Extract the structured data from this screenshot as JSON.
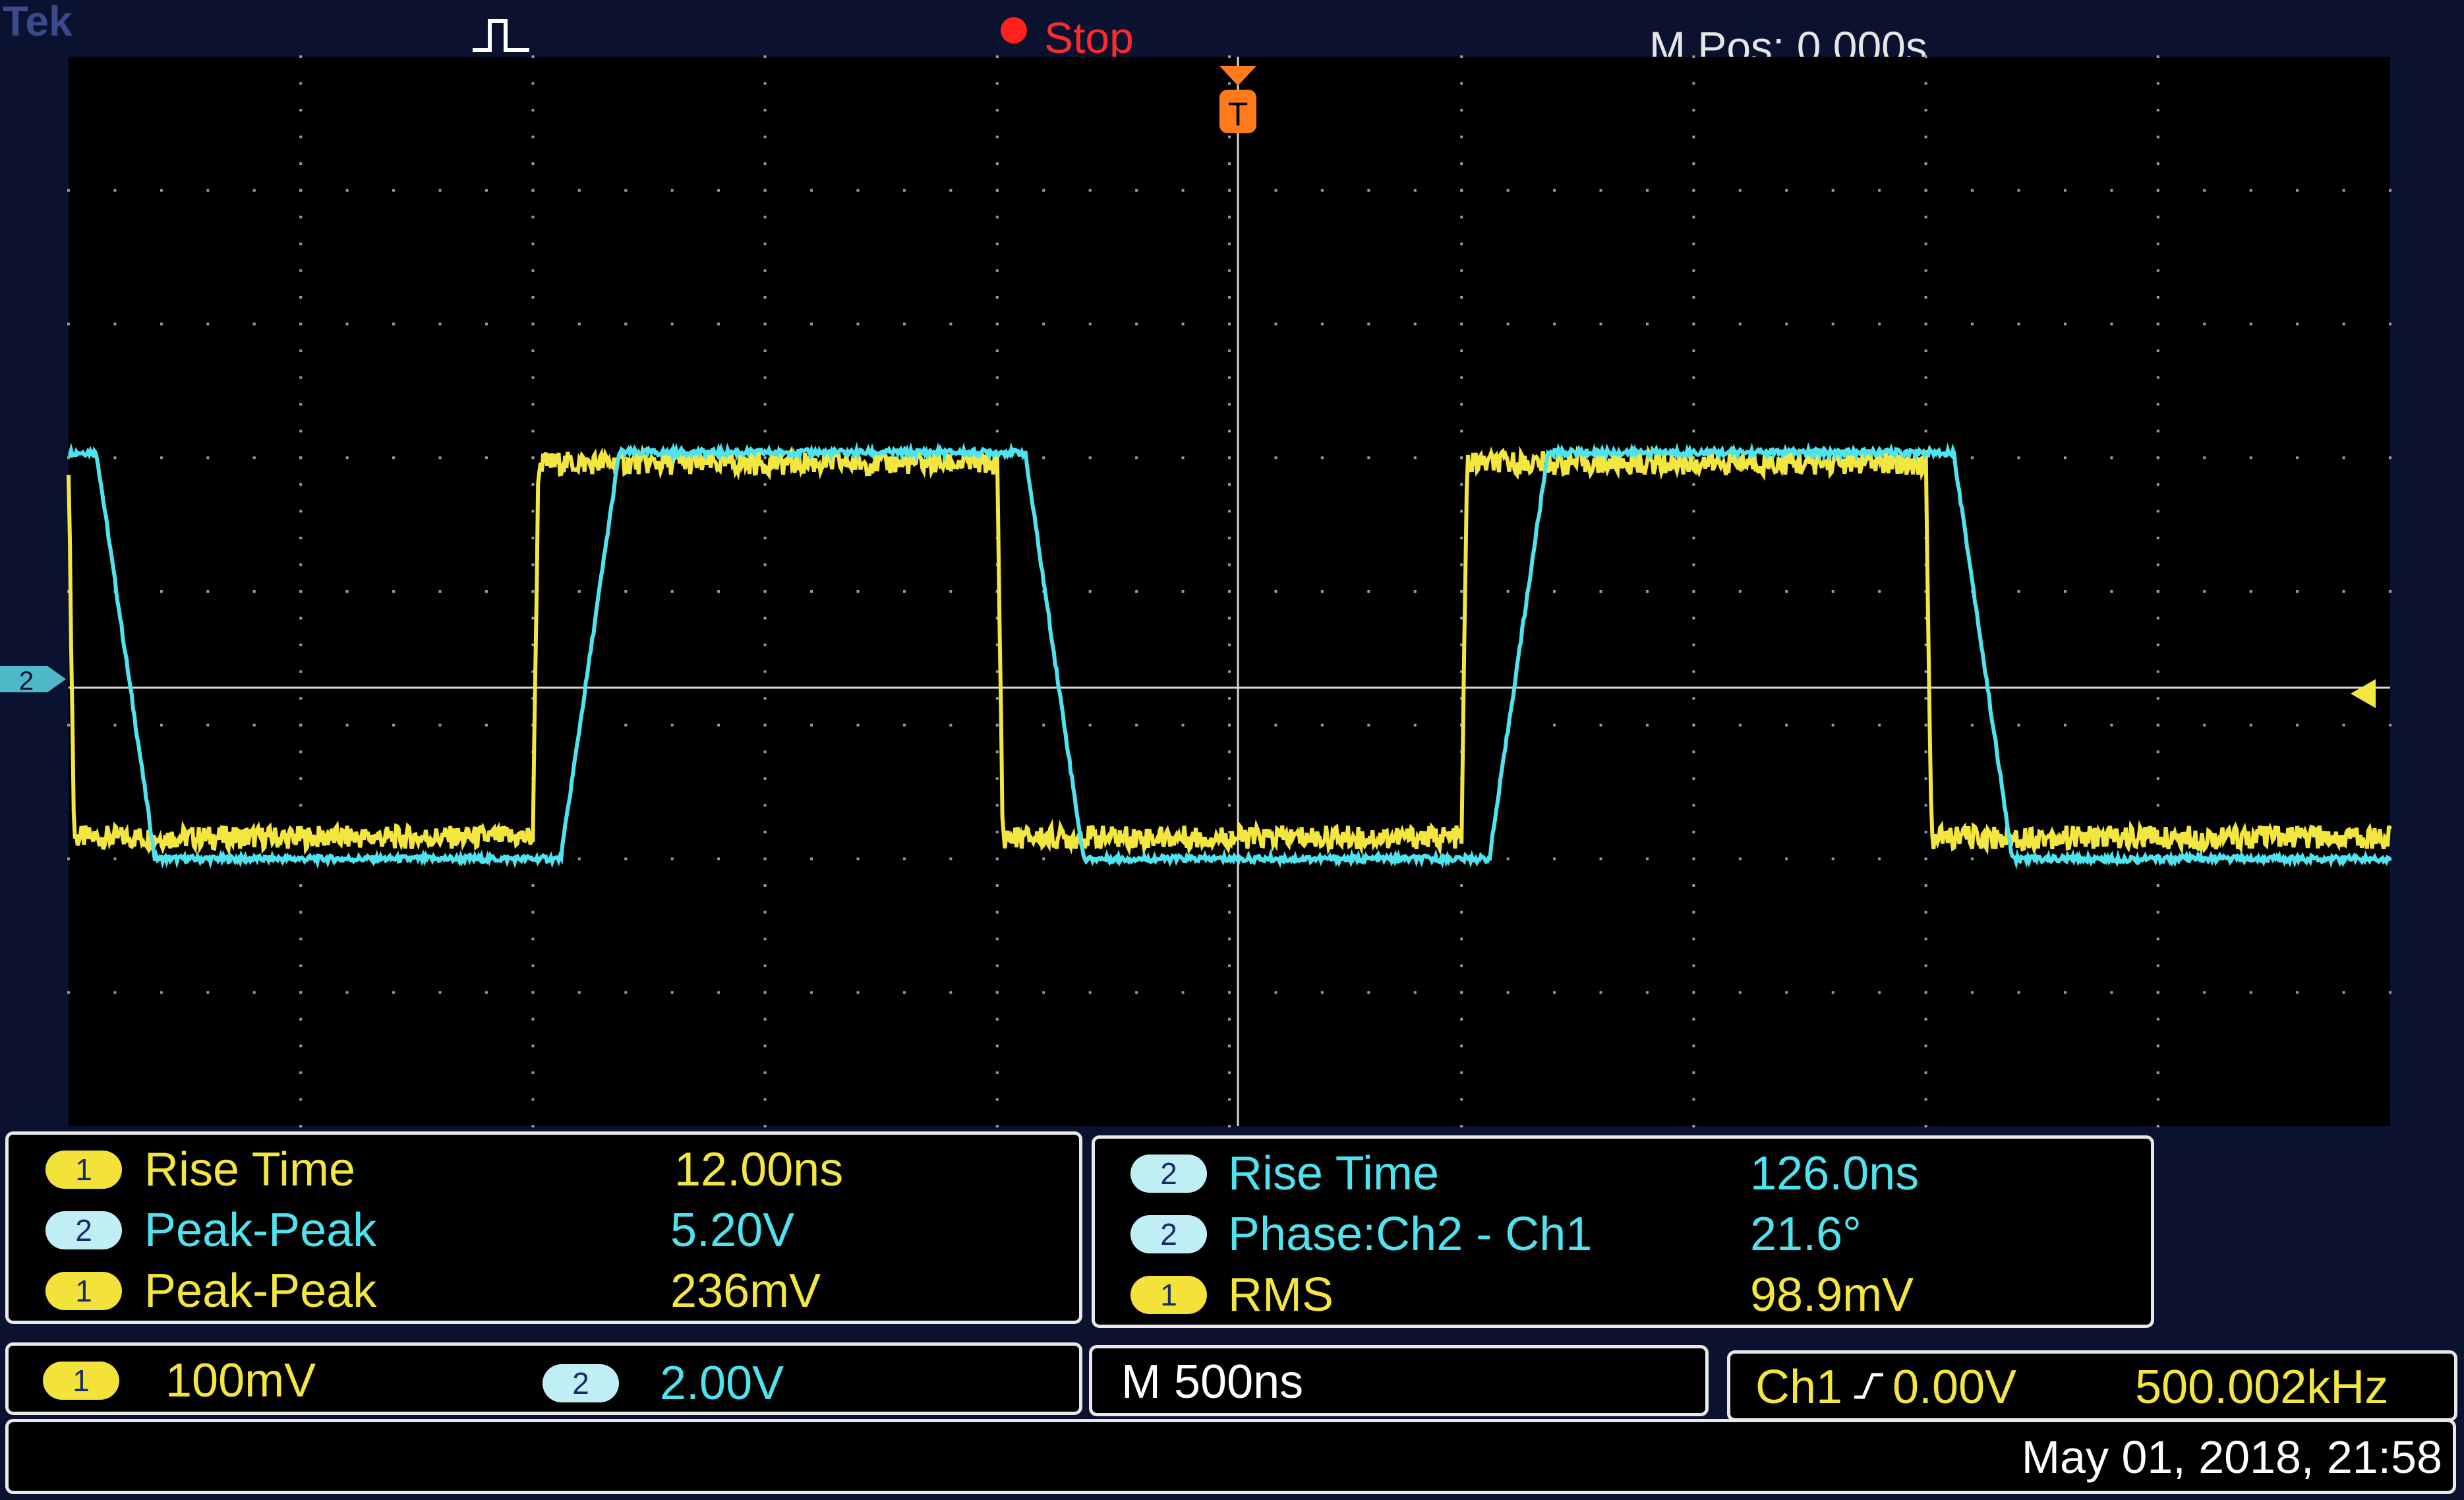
{
  "header": {
    "brand": "Tek",
    "acq_state": "Stop",
    "mpos_label": "M Pos: 0.000s"
  },
  "markers": {
    "ch2_marker": "2",
    "trigger_marker": "T"
  },
  "measurements": {
    "left": [
      {
        "ch": "1",
        "label": "Rise Time",
        "value": "12.00ns"
      },
      {
        "ch": "2",
        "label": "Peak-Peak",
        "value": "5.20V"
      },
      {
        "ch": "1",
        "label": "Peak-Peak",
        "value": "236mV"
      }
    ],
    "right": [
      {
        "ch": "2",
        "label": "Rise Time",
        "value": "126.0ns"
      },
      {
        "ch": "2",
        "label": "Phase:Ch2 - Ch1",
        "value": "21.6°"
      },
      {
        "ch": "1",
        "label": "RMS",
        "value": "98.9mV"
      }
    ]
  },
  "status": {
    "ch1_chip": "1",
    "ch1_scale": "100mV",
    "ch2_chip": "2",
    "ch2_scale": "2.00V",
    "timebase": "M 500ns",
    "trigger_source": "Ch1",
    "trigger_slope_icon": "rising-edge-icon",
    "trigger_level": "0.00V",
    "frequency": "500.002kHz",
    "datetime": "May 01, 2018, 21:58"
  },
  "waveforms": {
    "ch1": {
      "label": "1",
      "color": "#f4e640",
      "high": 40,
      "low": 5,
      "rise_time_ns": 12
    },
    "ch2": {
      "label": "2",
      "color": "#4fe3f0",
      "high": 41,
      "low": 3,
      "rise_time_ns": 126
    },
    "period_ns": 2000,
    "first_rising_edge_ns": -1500
  },
  "colors": {
    "ch1": "#f4e640",
    "ch2": "#4fe3f0",
    "acq_stop": "#ff2020",
    "screen_bg": "#0b1230"
  }
}
